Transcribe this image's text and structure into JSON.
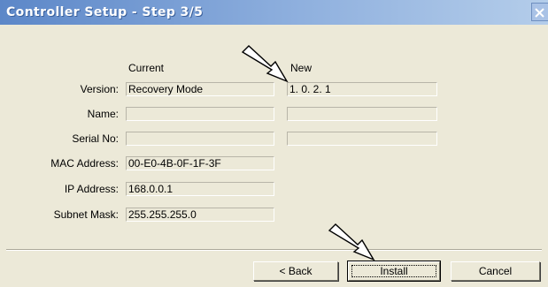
{
  "window": {
    "title": "Controller Setup - Step 3/5"
  },
  "columns": {
    "current": "Current",
    "new": "New"
  },
  "fields": {
    "version": {
      "label": "Version:",
      "current": "Recovery Mode",
      "new": "1. 0. 2. 1"
    },
    "name": {
      "label": "Name:",
      "current": "",
      "new": ""
    },
    "serial": {
      "label": "Serial No:",
      "current": "",
      "new": ""
    },
    "mac": {
      "label": "MAC Address:",
      "current": "00-E0-4B-0F-1F-3F"
    },
    "ip": {
      "label": "IP Address:",
      "current": "168.0.0.1"
    },
    "subnet": {
      "label": "Subnet Mask:",
      "current": "255.255.255.0"
    }
  },
  "buttons": {
    "back": "< Back",
    "install": "Install",
    "cancel": "Cancel"
  },
  "icons": {
    "close": "close-icon",
    "annotation_arrow": "arrow-icon"
  }
}
